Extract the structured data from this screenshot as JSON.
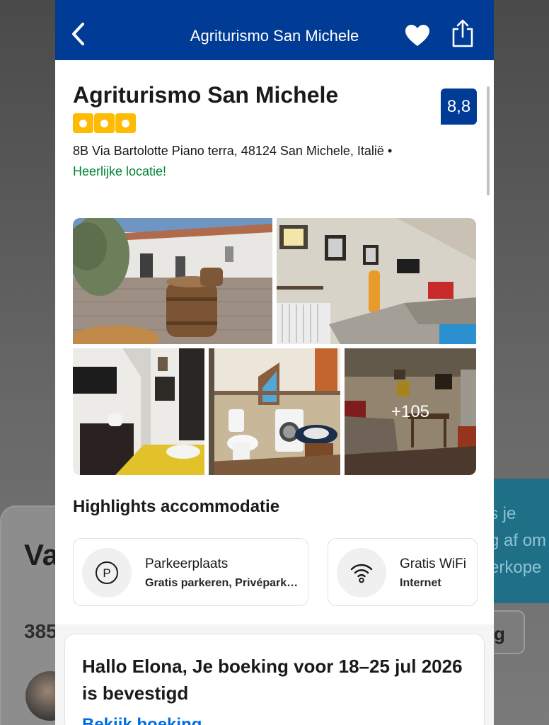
{
  "background": {
    "left_title": "Va",
    "left_count": "385",
    "right_lines": [
      "s je",
      "g af om",
      "erkope"
    ],
    "right_button": "g"
  },
  "header": {
    "title": "Agriturismo San Michele",
    "back_icon": "chevron-left-icon",
    "favorite_icon": "heart-icon",
    "share_icon": "share-icon"
  },
  "property": {
    "name": "Agriturismo San Michele",
    "star_count": 3,
    "rating": "8,8",
    "address": "8B Via Bartolotte Piano terra, 48124 San Michele, Italië •",
    "location_label": "Heerlijke locatie!"
  },
  "gallery": {
    "more_count": "+105"
  },
  "highlights": {
    "title": "Highlights accommodatie",
    "items": [
      {
        "icon": "parking-icon",
        "title": "Parkeerplaats",
        "subtitle": "Gratis parkeren, Privépark…"
      },
      {
        "icon": "wifi-icon",
        "title": "Gratis WiFi",
        "subtitle": "Internet"
      }
    ]
  },
  "booking_notice": {
    "text": "Hallo Elona, Je boeking voor 18–25 jul 2026 is bevestigd",
    "link": "Bekijk boeking"
  },
  "colors": {
    "brand_blue": "#003b95",
    "star_yellow": "#febb02",
    "location_green": "#008234",
    "link_blue": "#006ce4"
  }
}
